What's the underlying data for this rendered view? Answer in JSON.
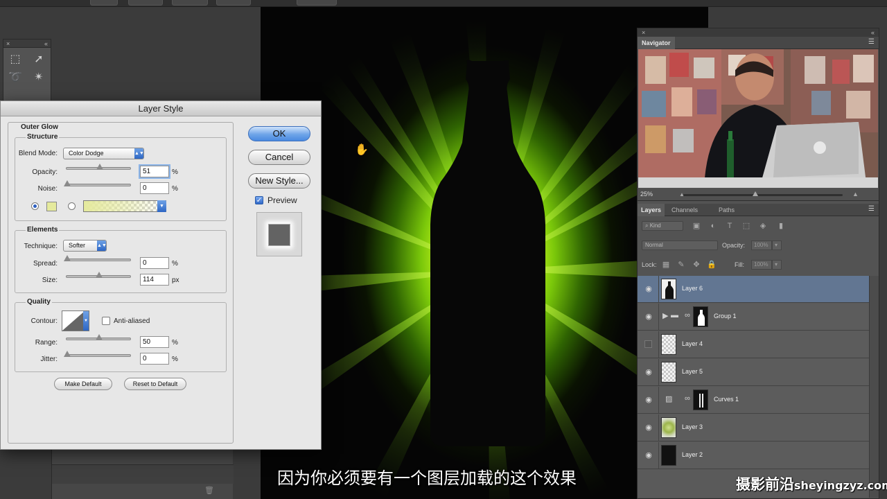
{
  "dialog": {
    "title": "Layer Style",
    "section": "Outer Glow",
    "structure": {
      "legend": "Structure",
      "blend_mode_label": "Blend Mode:",
      "blend_mode": "Color Dodge",
      "opacity_label": "Opacity:",
      "opacity": "51",
      "noise_label": "Noise:",
      "noise": "0",
      "percent": "%"
    },
    "elements": {
      "legend": "Elements",
      "technique_label": "Technique:",
      "technique": "Softer",
      "spread_label": "Spread:",
      "spread": "0",
      "size_label": "Size:",
      "size": "114",
      "percent": "%",
      "px": "px"
    },
    "quality": {
      "legend": "Quality",
      "contour_label": "Contour:",
      "anti_aliased": "Anti-aliased",
      "range_label": "Range:",
      "range": "50",
      "jitter_label": "Jitter:",
      "jitter": "0",
      "percent": "%"
    },
    "make_default": "Make Default",
    "reset_default": "Reset to Default",
    "ok": "OK",
    "cancel": "Cancel",
    "new_style": "New Style...",
    "preview": "Preview",
    "glow_color": "#e5ea9d"
  },
  "navigator": {
    "tab": "Navigator",
    "zoom": "25%"
  },
  "layers_panel": {
    "tabs": [
      "Layers",
      "Channels",
      "Paths"
    ],
    "filter_kind": "Kind",
    "blend_mode": "Normal",
    "opacity_label": "Opacity:",
    "opacity": "100%",
    "lock_label": "Lock:",
    "fill_label": "Fill:",
    "fill": "100%",
    "layers": [
      {
        "name": "Layer 6",
        "selected": true
      },
      {
        "name": "Group 1"
      },
      {
        "name": "Layer 4",
        "hidden": true
      },
      {
        "name": "Layer 5"
      },
      {
        "name": "Curves 1"
      },
      {
        "name": "Layer 3"
      },
      {
        "name": "Layer 2"
      }
    ]
  },
  "subtitle": "因为你必须要有一个图层加载的这个效果",
  "logo": {
    "cn": "摄影前沿",
    "url": "sheyingzyz.com"
  },
  "colors": {
    "canvas_glow": "#d8ff22",
    "selected_layer": "#627692",
    "accent_button": "#6ea4e8"
  }
}
